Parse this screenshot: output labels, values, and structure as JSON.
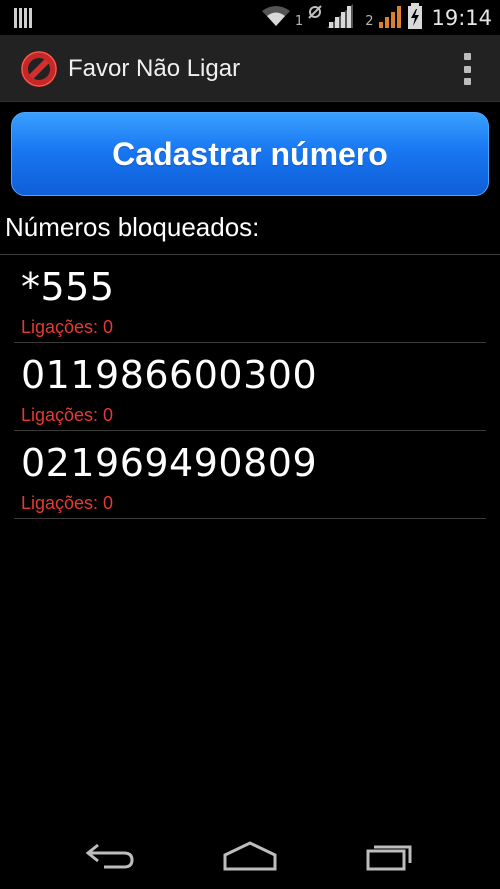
{
  "status_bar": {
    "sim1_label": "1",
    "sim2_label": "2",
    "time": "19:14",
    "icons": [
      "notification-icon",
      "wifi-icon",
      "sync-icon",
      "signal-icon",
      "signal-icon",
      "battery-charging-icon"
    ]
  },
  "action_bar": {
    "title": "Favor Não Ligar",
    "app_icon": "no-entry-icon",
    "overflow_icon": "overflow-menu-icon"
  },
  "main": {
    "register_button_label": "Cadastrar número",
    "section_label": "Números bloqueados:",
    "blocked_numbers": [
      {
        "number": "*555",
        "calls_label": "Ligações: 0"
      },
      {
        "number": "011986600300",
        "calls_label": "Ligações: 0"
      },
      {
        "number": "021969490809",
        "calls_label": "Ligações: 0"
      }
    ]
  },
  "nav_bar": {
    "icons": [
      "back-icon",
      "home-icon",
      "recent-apps-icon"
    ]
  },
  "colors": {
    "button_blue": "#1877f2",
    "call_count_red": "#e53935",
    "action_bar_bg": "#222222"
  }
}
